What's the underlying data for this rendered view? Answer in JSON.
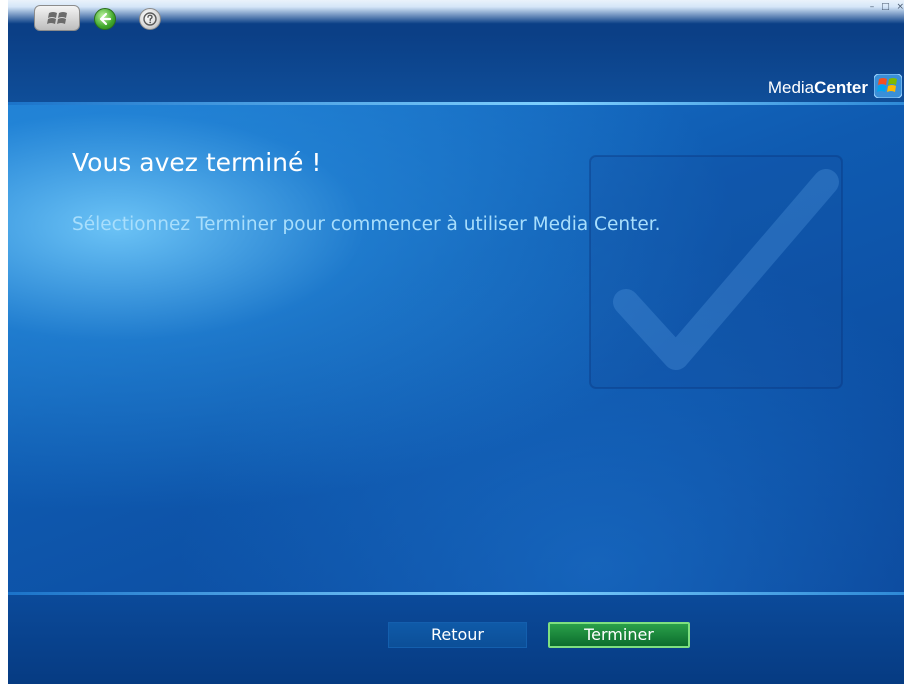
{
  "window": {
    "controls": [
      "–",
      "□",
      "×"
    ]
  },
  "header": {
    "logo_thin": "Media",
    "logo_bold": "Center"
  },
  "main": {
    "title": "Vous avez terminé !",
    "subtitle": "Sélectionnez Terminer pour commencer à utiliser Media Center."
  },
  "footer": {
    "back_label": "Retour",
    "finish_label": "Terminer"
  },
  "colors": {
    "background": "#0a3f86",
    "subtitle_text": "#a8defc",
    "finish_button": "#1b8a3c"
  },
  "icons": {
    "start": "windows-start-icon",
    "back": "back-arrow-icon",
    "help": "help-icon",
    "decoration": "checkmark-icon"
  }
}
